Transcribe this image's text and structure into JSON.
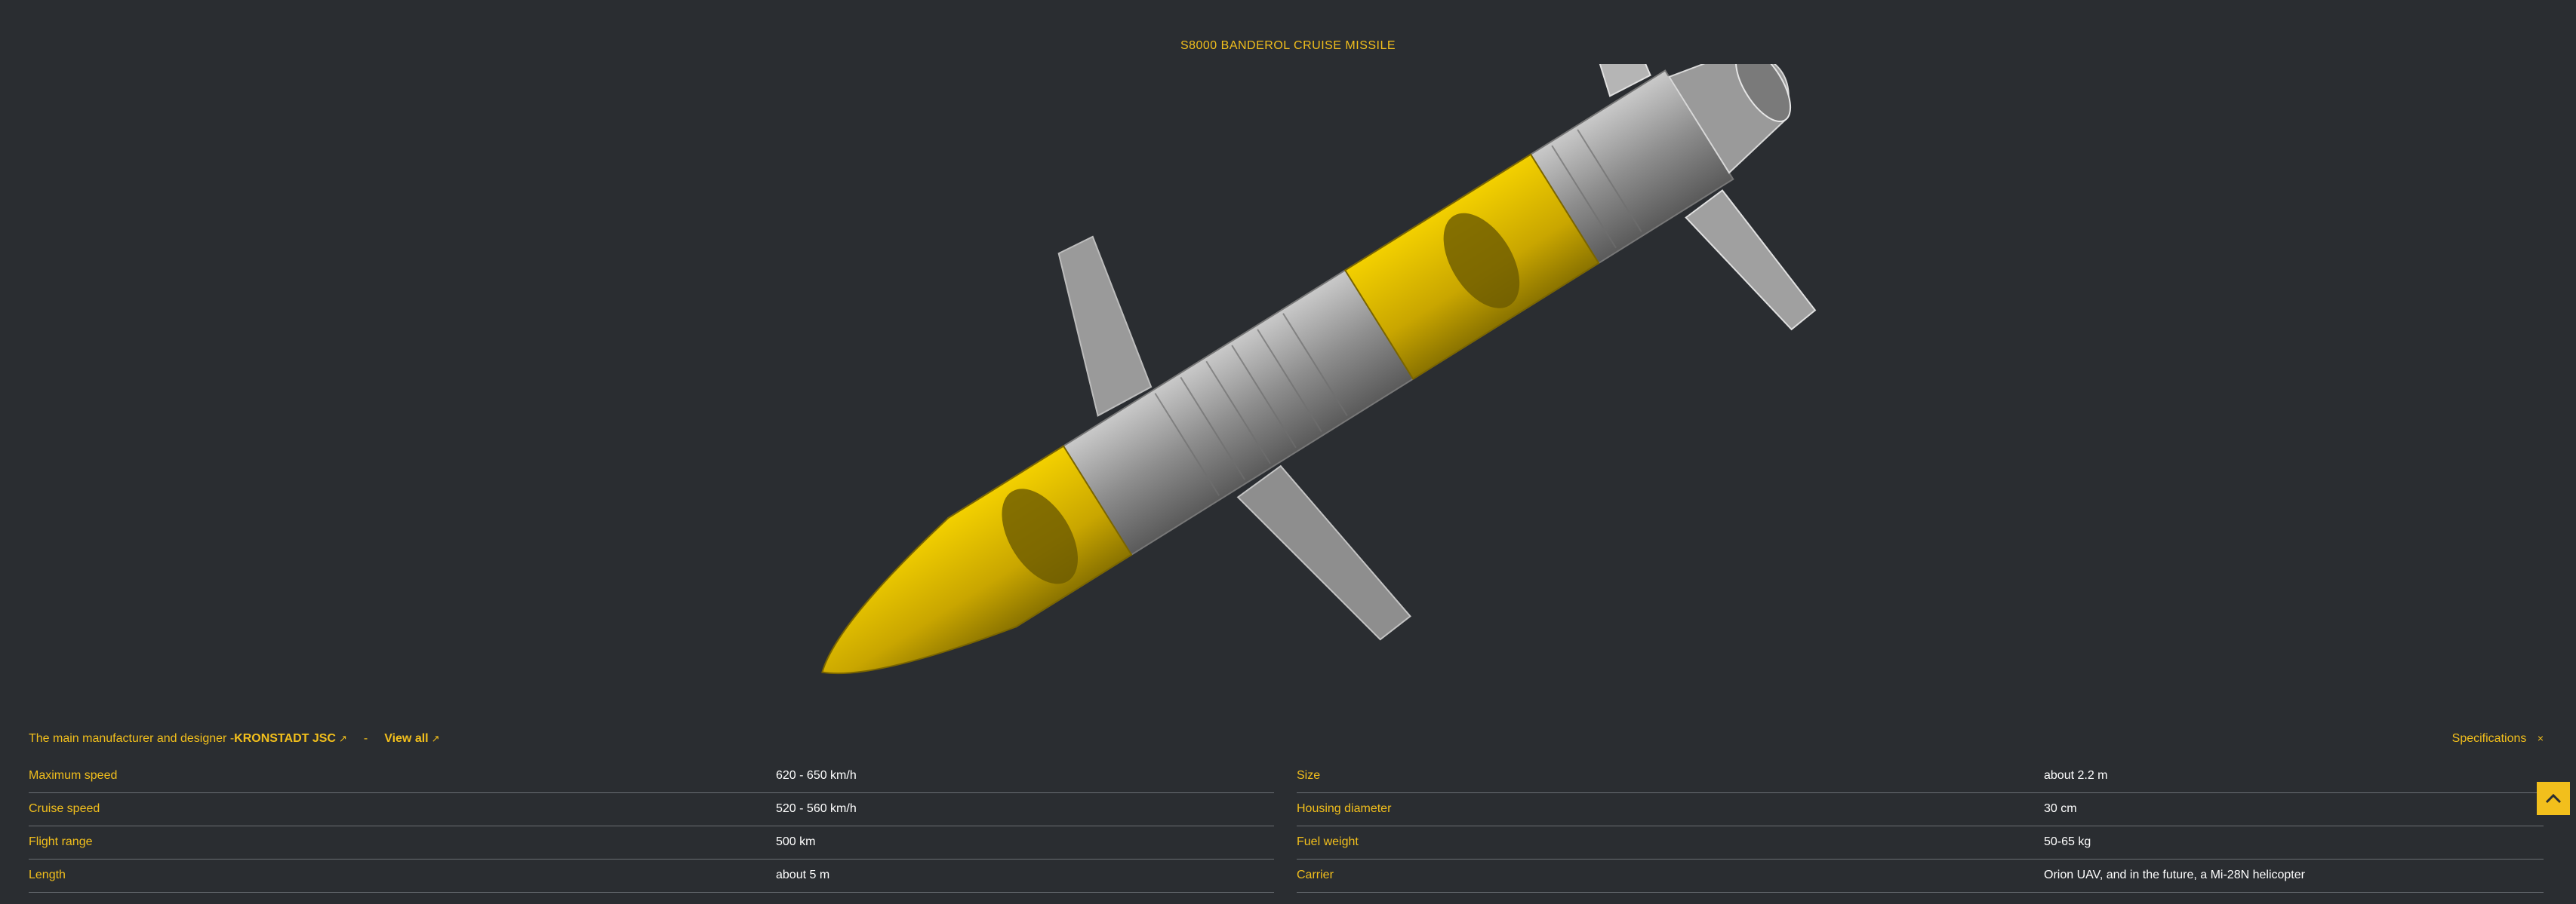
{
  "title": "S8000 BANDEROL CRUISE MISSILE",
  "manufacturer": {
    "prefix": "The main manufacturer and designer - ",
    "name": "KRONSTADT JSC",
    "separator": "-",
    "view_all": "View all",
    "external_icon": "external-link-icon"
  },
  "specs_toggle": {
    "label": "Specifications",
    "close_icon": "×"
  },
  "specs_left": [
    {
      "key": "Maximum speed",
      "value": "620 - 650 km/h"
    },
    {
      "key": "Cruise speed",
      "value": "520 - 560 km/h"
    },
    {
      "key": "Flight range",
      "value": "500 km"
    },
    {
      "key": "Length",
      "value": "about 5 m"
    }
  ],
  "specs_right": [
    {
      "key": "Size",
      "value": "about 2.2 m"
    },
    {
      "key": "Housing diameter",
      "value": "30 cm"
    },
    {
      "key": "Fuel weight",
      "value": "50-65 kg"
    },
    {
      "key": "Carrier",
      "value": "Orion UAV, and in the future, a Mi-28N helicopter"
    }
  ],
  "scroll_top_icon": "chevron-up-icon",
  "colors": {
    "background": "#2a2d31",
    "accent": "#f2bf1c",
    "text": "#ffffff",
    "divider": "#6a6e73"
  }
}
